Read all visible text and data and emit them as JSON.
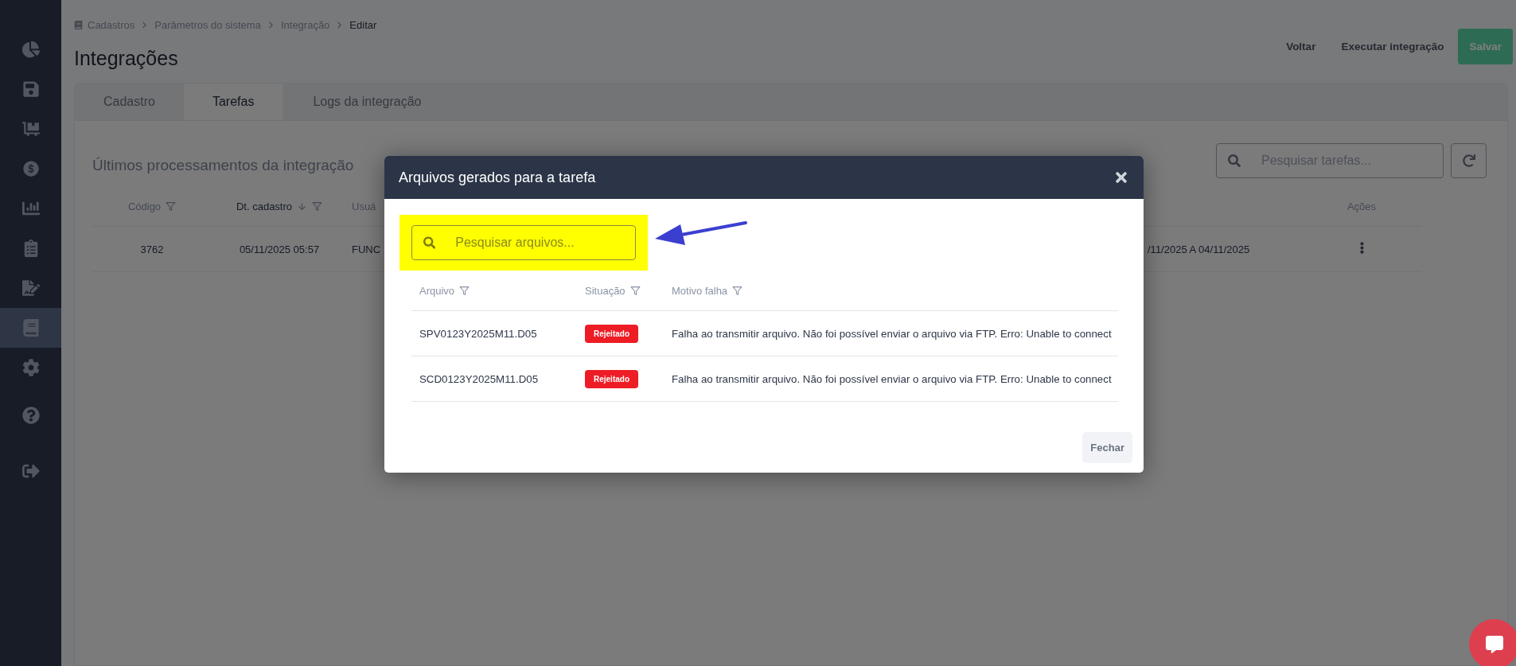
{
  "sidebar": {
    "items": [
      {
        "selected": false
      },
      {
        "selected": false
      },
      {
        "selected": false
      },
      {
        "selected": false
      },
      {
        "selected": false
      },
      {
        "selected": false
      },
      {
        "selected": false
      },
      {
        "selected": true
      },
      {
        "selected": false
      },
      {
        "selected": false
      },
      {
        "selected": false
      }
    ]
  },
  "breadcrumb": [
    {
      "label": "Cadastros",
      "current": false
    },
    {
      "label": "Parâmetros do sistema",
      "current": false
    },
    {
      "label": "Integração",
      "current": false
    },
    {
      "label": "Editar",
      "current": true
    }
  ],
  "page_title": "Integrações",
  "header_buttons": [
    {
      "label": "Voltar",
      "kind": "text"
    },
    {
      "label": "Executar integração",
      "kind": "text"
    },
    {
      "label": "Salvar",
      "kind": "primary"
    }
  ],
  "tabs": [
    {
      "label": "Cadastro",
      "selected": false
    },
    {
      "label": "Tarefas",
      "selected": true
    },
    {
      "label": "Logs da integração",
      "selected": false
    }
  ],
  "section_title": "Últimos processamentos da integração",
  "search": {
    "placeholder": "Pesquisar tarefas..."
  },
  "table": {
    "columns": [
      {
        "label": "Código",
        "filter": true,
        "sort_desc": false
      },
      {
        "label": "Dt. cadastro",
        "filter": true,
        "sort_desc": true
      },
      {
        "label": "Usuá",
        "filter": false,
        "sort_desc": false
      },
      {
        "filter": false,
        "sort_desc": false
      },
      {
        "label": "Ações",
        "filter": false,
        "sort_desc": false
      }
    ],
    "rows": [
      {
        "cells": [
          "3762",
          "05/11/2025 05:57",
          "FUNC",
          "/11/2025 A 04/11/2025"
        ]
      }
    ]
  },
  "modal": {
    "title": "Arquivos gerados para a tarefa",
    "search": {
      "placeholder": "Pesquisar arquivos...",
      "highlighted": true
    },
    "columns": [
      {
        "label": "Arquivo"
      },
      {
        "label": "Situação"
      },
      {
        "label": "Motivo falha"
      }
    ],
    "rows": [
      {
        "arquivo": "SPV0123Y2025M11.D05",
        "situacao": "Rejeitado",
        "motivo": "Falha ao transmitir arquivo. Não foi possível enviar o arquivo via FTP. Erro: Unable to connect"
      },
      {
        "arquivo": "SCD0123Y2025M11.D05",
        "situacao": "Rejeitado",
        "motivo": "Falha ao transmitir arquivo. Não foi possível enviar o arquivo via FTP. Erro: Unable to connect"
      }
    ],
    "close_button": "Fechar"
  }
}
